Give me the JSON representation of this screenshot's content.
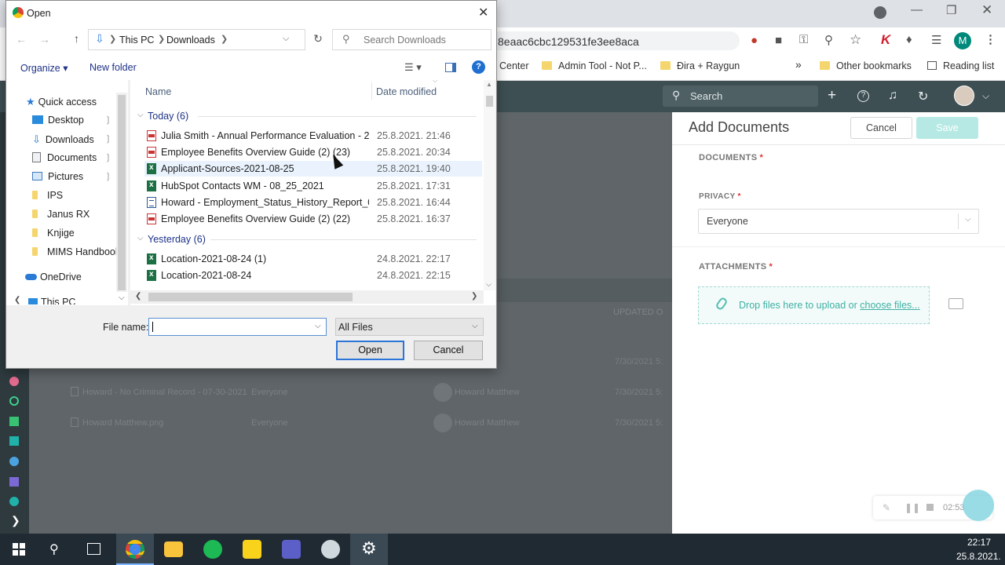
{
  "browser": {
    "address_fragment": "8eaac6cbc129531fe3ee8aca",
    "bookmarks": [
      "Center",
      "Admin Tool - Not P...",
      "Đira + Raygun",
      "»",
      "Other bookmarks",
      "Reading list"
    ],
    "profile_initial": "M"
  },
  "app": {
    "search_placeholder": "Search",
    "background_column": "UPDATED O",
    "background_rows": [
      {
        "name": "Howard - No Criminal Record - 07-30-2021",
        "privacy": "Everyone",
        "owner": "Howard Matthew",
        "date": "7/30/2021 5:"
      },
      {
        "name": "Howard Matthew.png",
        "privacy": "Everyone",
        "owner": "Howard Matthew",
        "date": "7/30/2021 5:"
      }
    ],
    "bg_partial_date": "7/30/2021 5:"
  },
  "panel": {
    "title": "Add Documents",
    "cancel_label": "Cancel",
    "save_label": "Save",
    "documents_label": "DOCUMENTS",
    "privacy_label": "PRIVACY",
    "privacy_value": "Everyone",
    "attachments_label": "ATTACHMENTS",
    "drop_text": "Drop files here to upload or ",
    "choose_link": "choose files...",
    "required_mark": "*"
  },
  "recorder": {
    "time": "02:53"
  },
  "taskbar": {
    "time": "22:17",
    "date": "25.8.2021."
  },
  "dialog": {
    "title": "Open",
    "breadcrumb": [
      "This PC",
      "Downloads"
    ],
    "search_placeholder": "Search Downloads",
    "organize_label": "Organize",
    "new_folder_label": "New folder",
    "col_name": "Name",
    "col_date": "Date modified",
    "nav_items": [
      "Quick access",
      "Desktop",
      "Downloads",
      "Documents",
      "Pictures",
      "IPS",
      "Janus RX",
      "Knjige",
      "MIMS Handbool",
      "OneDrive",
      "This PC"
    ],
    "groups": [
      {
        "label": "Today (6)",
        "files": [
          {
            "name": "Julia Smith - Annual Performance Evaluation - 2...",
            "date": "25.8.2021. 21:46",
            "type": "pdf"
          },
          {
            "name": "Employee Benefits Overview Guide (2) (23)",
            "date": "25.8.2021. 20:34",
            "type": "pdf"
          },
          {
            "name": "Applicant-Sources-2021-08-25",
            "date": "25.8.2021. 19:40",
            "type": "xls"
          },
          {
            "name": "HubSpot Contacts WM - 08_25_2021",
            "date": "25.8.2021. 17:31",
            "type": "xls"
          },
          {
            "name": "Howard - Employment_Status_History_Report_0...",
            "date": "25.8.2021. 16:44",
            "type": "doc"
          },
          {
            "name": "Employee Benefits Overview Guide (2) (22)",
            "date": "25.8.2021. 16:37",
            "type": "pdf"
          }
        ]
      },
      {
        "label": "Yesterday (6)",
        "files": [
          {
            "name": "Location-2021-08-24 (1)",
            "date": "24.8.2021. 22:17",
            "type": "xls"
          },
          {
            "name": "Location-2021-08-24",
            "date": "24.8.2021. 22:15",
            "type": "xls"
          }
        ]
      }
    ],
    "file_name_label": "File name:",
    "file_name_value": "",
    "file_type": "All Files",
    "open_label": "Open",
    "cancel_label": "Cancel"
  }
}
